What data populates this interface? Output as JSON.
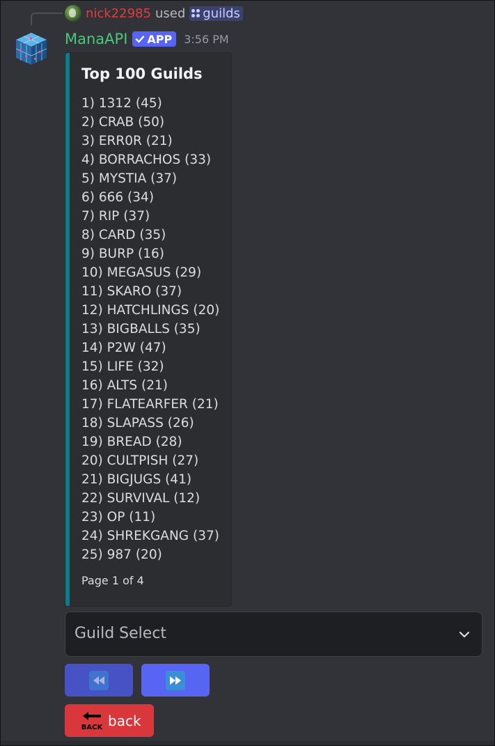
{
  "reply": {
    "username": "nick22985",
    "used_text": "used",
    "command": "guilds"
  },
  "message": {
    "author": "ManaAPI",
    "badge": "APP",
    "timestamp": "3:56 PM"
  },
  "embed": {
    "accent_color": "#0b7d89",
    "title": "Top 100 Guilds",
    "entries": [
      "1) 1312 (45)",
      "2) CRAB (50)",
      "3) ERR0R (21)",
      "4) BORRACHOS (33)",
      "5) MYSTIA (37)",
      "6) 666 (34)",
      "7) RIP (37)",
      "8) CARD (35)",
      "9) BURP (16)",
      "10) MEGASUS (29)",
      "11) SKARO (37)",
      "12) HATCHLINGS (20)",
      "13) BIGBALLS (35)",
      "14) P2W (47)",
      "15) LIFE (32)",
      "16) ALTS (21)",
      "17) FLATEARFER (21)",
      "18) SLAPASS (26)",
      "19) BREAD (28)",
      "20) CULTPISH (27)",
      "21) BIGJUGS (41)",
      "22) SURVIVAL (12)",
      "23) OP (11)",
      "24) SHREKGANG (37)",
      "25) 987 (20)"
    ],
    "footer": "Page 1 of 4"
  },
  "select": {
    "placeholder": "Guild Select",
    "icon": "chevron-down-icon"
  },
  "buttons": {
    "prev_icon": "rewind-icon",
    "next_icon": "fast-forward-icon",
    "back_label": "back",
    "back_emoji_text": "BACK",
    "prev_state": "disabled"
  },
  "colors": {
    "username": "#4dc77d",
    "reply_user": "#e23d3d",
    "app_badge": "#5865f2",
    "blurple": "#5865f2",
    "danger": "#da373c"
  }
}
